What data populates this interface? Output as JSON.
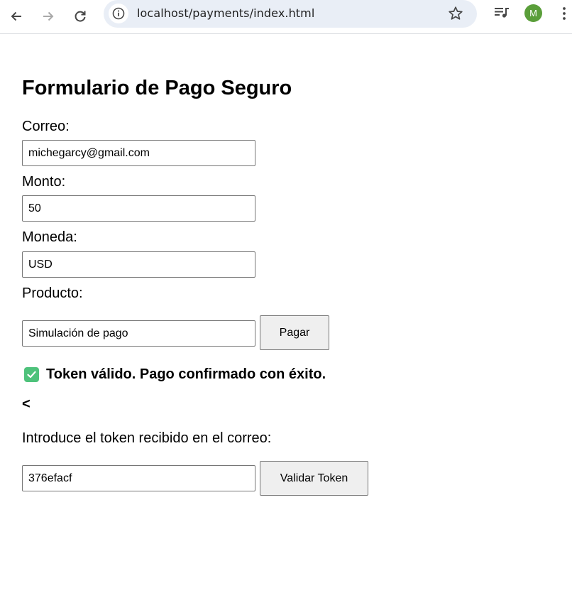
{
  "browser": {
    "url": "localhost/payments/index.html",
    "avatar_initial": "M",
    "icons": [
      "back-arrow-icon",
      "forward-arrow-icon",
      "reload-icon",
      "info-icon",
      "star-icon",
      "media-queue-icon",
      "kebab-menu-icon"
    ]
  },
  "form": {
    "title": "Formulario de Pago Seguro",
    "email_label": "Correo:",
    "email_value": "michegarcy@gmail.com",
    "amount_label": "Monto:",
    "amount_value": "50",
    "currency_label": "Moneda:",
    "currency_value": "USD",
    "product_label": "Producto:",
    "product_value": "Simulación de pago",
    "pay_button": "Pagar"
  },
  "result": {
    "message": "Token válido. Pago confirmado con éxito.",
    "stray_text": "<"
  },
  "token": {
    "label": "Introduce el token recibido en el correo:",
    "value": "376efacf",
    "validate_button": "Validar Token"
  },
  "colors": {
    "success": "#4ec27b",
    "omnibox": "#e9eef6",
    "avatar": "#5a9e3a"
  }
}
